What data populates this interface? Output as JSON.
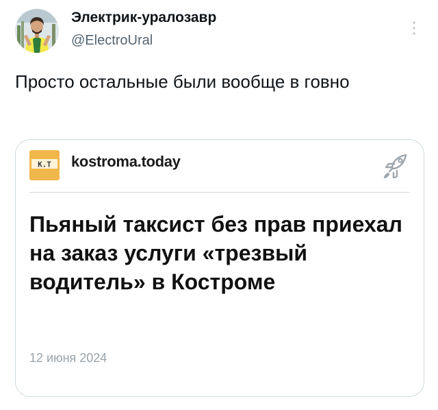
{
  "author": {
    "display_name": "Электрик-уралозавр",
    "handle": "@ElectroUral"
  },
  "tweet": {
    "text": "Просто остальные были вообще в говно"
  },
  "link_card": {
    "logo_text": "К.Т",
    "site": "kostroma.today",
    "headline": "Пьяный таксист без прав приехал на заказ услуги «трезвый водитель» в Костроме",
    "date": "12 июня 2024"
  },
  "icons": {
    "more": "more-vertical-icon",
    "share": "rocket-icon",
    "logo": "kostroma-today-logo"
  },
  "colors": {
    "text": "#0f1419",
    "secondary": "#536471",
    "border": "#cfd9de",
    "logo_bg": "#f0b84a",
    "logo_text": "#3a3a3a",
    "date": "#9aa3aa"
  }
}
